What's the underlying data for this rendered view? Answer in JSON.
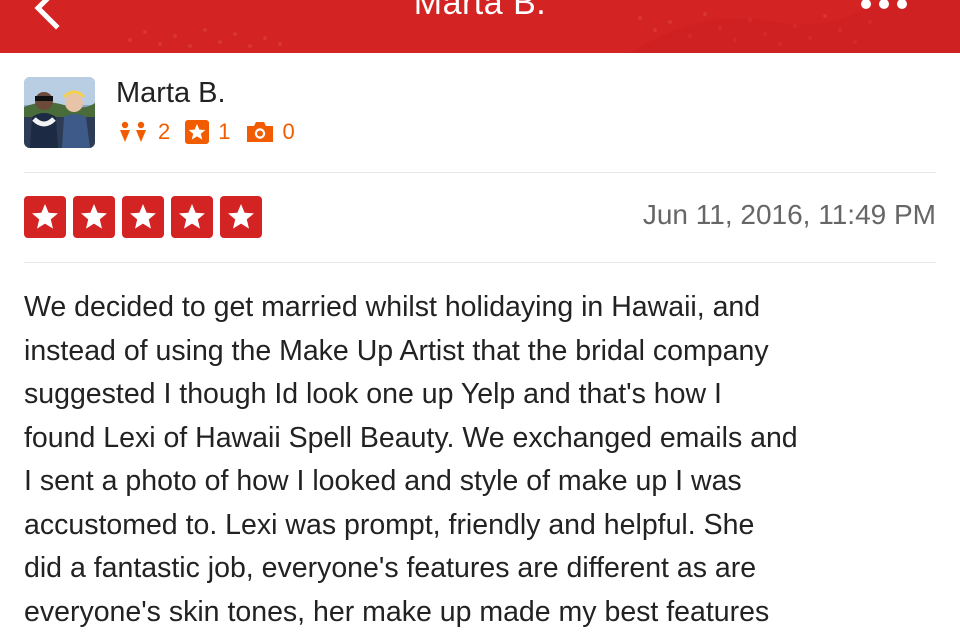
{
  "header": {
    "title": "Marta B.",
    "color": "#d32323"
  },
  "user": {
    "name": "Marta B.",
    "friends_count": "2",
    "reviews_count": "1",
    "photos_count": "0",
    "stat_color": "#f15c00"
  },
  "review": {
    "rating": 5,
    "rating_max": 5,
    "date": "Jun 11, 2016, 11:49 PM",
    "lines": [
      "We decided to get married whilst holidaying in Hawaii, and",
      "instead of using the Make Up Artist that the bridal company",
      "suggested I though Id look one up Yelp and that's how I",
      "found Lexi of Hawaii Spell Beauty. We exchanged emails and",
      "I sent a photo of how I looked and style of make up I was",
      "accustomed to. Lexi was prompt, friendly and helpful. She",
      "did a fantastic job, everyone's features are different as are",
      "everyone's skin tones, her make up made my best features"
    ]
  },
  "icons": {
    "back": "chevron-left-icon",
    "more": "more-dots-icon",
    "friends": "friends-icon",
    "reviews": "review-star-icon",
    "photos": "camera-icon",
    "star": "star-icon"
  }
}
